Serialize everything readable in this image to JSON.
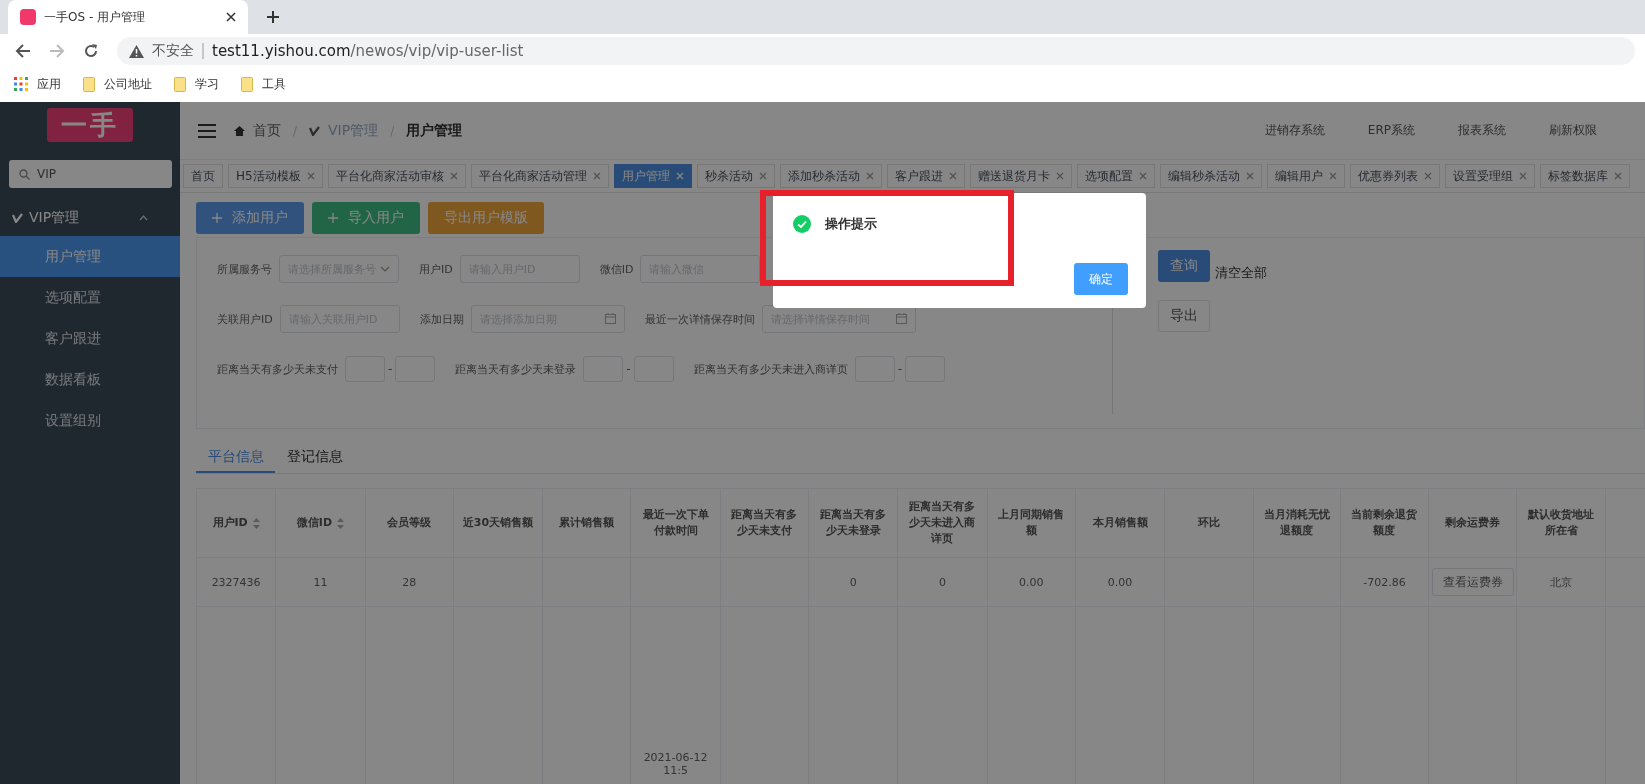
{
  "browser": {
    "tab_title": "一手OS - 用户管理",
    "security": "不安全",
    "url_host": "test11.yishou.com",
    "url_path": "/newos/vip/vip-user-list",
    "bookmarks": [
      "应用",
      "公司地址",
      "学习",
      "工具"
    ]
  },
  "sidebar": {
    "logo": "一手",
    "search": {
      "value": "VIP"
    },
    "group": {
      "label": "VIP管理",
      "expanded": true
    },
    "items": [
      {
        "label": "用户管理",
        "selected": true
      },
      {
        "label": "选项配置",
        "selected": false
      },
      {
        "label": "客户跟进",
        "selected": false
      },
      {
        "label": "数据看板",
        "selected": false
      },
      {
        "label": "设置组别",
        "selected": false
      }
    ]
  },
  "header": {
    "breadcrumbs": [
      "首页",
      "VIP管理",
      "用户管理"
    ],
    "separator": "/",
    "links": [
      "进销存系统",
      "ERP系统",
      "报表系统",
      "刷新权限"
    ]
  },
  "tags": [
    {
      "label": "首页",
      "selected": false,
      "closable": false
    },
    {
      "label": "H5活动模板",
      "selected": false,
      "closable": true
    },
    {
      "label": "平台化商家活动审核",
      "selected": false,
      "closable": true
    },
    {
      "label": "平台化商家活动管理",
      "selected": false,
      "closable": true
    },
    {
      "label": "用户管理",
      "selected": true,
      "closable": true
    },
    {
      "label": "秒杀活动",
      "selected": false,
      "closable": true
    },
    {
      "label": "添加秒杀活动",
      "selected": false,
      "closable": true
    },
    {
      "label": "客户跟进",
      "selected": false,
      "closable": true
    },
    {
      "label": "赠送退货月卡",
      "selected": false,
      "closable": true
    },
    {
      "label": "选项配置",
      "selected": false,
      "closable": true
    },
    {
      "label": "编辑秒杀活动",
      "selected": false,
      "closable": true
    },
    {
      "label": "编辑用户",
      "selected": false,
      "closable": true
    },
    {
      "label": "优惠券列表",
      "selected": false,
      "closable": true
    },
    {
      "label": "设置受理组",
      "selected": false,
      "closable": true
    },
    {
      "label": "标签数据库",
      "selected": false,
      "closable": true
    }
  ],
  "actions": [
    {
      "label": "添加用户",
      "kind": "add"
    },
    {
      "label": "导入用户",
      "kind": "import"
    },
    {
      "label": "导出用户模版",
      "kind": "export"
    }
  ],
  "filters": [
    [
      {
        "label": "所属服务号",
        "kind": "select",
        "placeholder": "请选择所属服务号"
      },
      {
        "label": "用户ID",
        "kind": "input",
        "placeholder": "请输入用户ID"
      },
      {
        "label": "微信ID",
        "kind": "input",
        "placeholder": "请输入微信"
      }
    ],
    [
      {
        "label": "关联用户ID",
        "kind": "input",
        "placeholder": "请输入关联用户ID"
      },
      {
        "label": "添加日期",
        "kind": "date",
        "placeholder": "请选择添加日期"
      },
      {
        "label": "最近一次详情保存时间",
        "kind": "date",
        "placeholder": "请选择详情保存时间"
      }
    ],
    [
      {
        "label": "距离当天有多少天未支付",
        "kind": "range",
        "separator": "-"
      },
      {
        "label": "距离当天有多少天未登录",
        "kind": "range",
        "separator": "-"
      },
      {
        "label": "距离当天有多少天未进入商详页",
        "kind": "range",
        "separator": "-"
      }
    ]
  ],
  "search_buttons": {
    "query": "查询",
    "clear": "清空全部",
    "export": "导出"
  },
  "view_tabs": [
    {
      "label": "平台信息",
      "selected": true
    },
    {
      "label": "登记信息",
      "selected": false
    }
  ],
  "table": {
    "columns": [
      {
        "label": "用户ID",
        "sortable": true
      },
      {
        "label": "微信ID",
        "sortable": true
      },
      {
        "label": "会员等级",
        "sortable": false
      },
      {
        "label": "近30天销售额",
        "sortable": false
      },
      {
        "label": "累计销售额",
        "sortable": false
      },
      {
        "label": "最近一次下单付款时间",
        "sortable": false
      },
      {
        "label": "距离当天有多少天未支付",
        "sortable": false
      },
      {
        "label": "距离当天有多少天未登录",
        "sortable": false
      },
      {
        "label": "距离当天有多少天未进入商详页",
        "sortable": false
      },
      {
        "label": "上月同期销售额",
        "sortable": false
      },
      {
        "label": "本月销售额",
        "sortable": false
      },
      {
        "label": "环比",
        "sortable": false
      },
      {
        "label": "当月消耗无忧退额度",
        "sortable": false
      },
      {
        "label": "当前剩余退货额度",
        "sortable": false
      },
      {
        "label": "剩余运费券",
        "sortable": false
      },
      {
        "label": "默认收货地址所在省",
        "sortable": false
      }
    ],
    "rows": [
      {
        "cells": [
          "2327436",
          "11",
          "28",
          null,
          null,
          null,
          null,
          "0",
          "0",
          "0.00",
          "0.00",
          null,
          null,
          "-702.86",
          null,
          "北京"
        ],
        "button": "查看运费券"
      },
      {
        "cells": [
          null,
          null,
          null,
          null,
          null,
          "2021-06-12 11:5",
          null,
          null,
          null,
          null,
          null,
          null,
          null,
          null,
          null,
          null
        ]
      }
    ]
  },
  "dialog": {
    "title": "操作提示",
    "confirm": "确定"
  }
}
